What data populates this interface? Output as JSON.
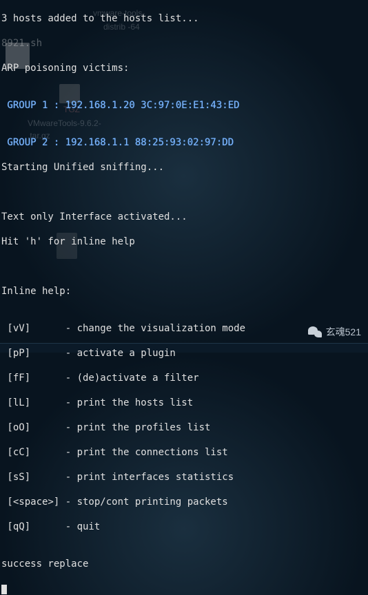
{
  "desktop": {
    "ghost_labels": {
      "file1": "vmware-tools-",
      "file2": "distrib        -64",
      "tgz": "TGZ",
      "vmtools": "VMwareTools-9.6.2-",
      "vmtools2": "         .tar.gz"
    }
  },
  "terminal": {
    "hosts_added": "3 hosts added to the hosts list...",
    "prev_sh": "8921.sh",
    "blank": "",
    "arp_line": "ARP poisoning victims:",
    "group1": " GROUP 1 : 192.168.1.20 3C:97:0E:E1:43:ED",
    "group2": " GROUP 2 : 192.168.1.1 88:25:93:02:97:DD",
    "sniff_start": "Starting Unified sniffing...",
    "text_iface": "Text only Interface activated...",
    "hit_h": "Hit 'h' for inline help",
    "inline_help_hdr": "Inline help:",
    "help_vv": " [vV]      - change the visualization mode",
    "help_pp": " [pP]      - activate a plugin",
    "help_ff": " [fF]      - (de)activate a filter",
    "help_ll": " [lL]      - print the hosts list",
    "help_oo": " [oO]      - print the profiles list",
    "help_cc": " [cC]      - print the connections list",
    "help_ss": " [sS]      - print interfaces statistics",
    "help_sp": " [<space>] - stop/cont printing packets",
    "help_qq": " [qQ]      - quit",
    "success": "success replace"
  },
  "watermark": {
    "text": "玄魂521"
  }
}
